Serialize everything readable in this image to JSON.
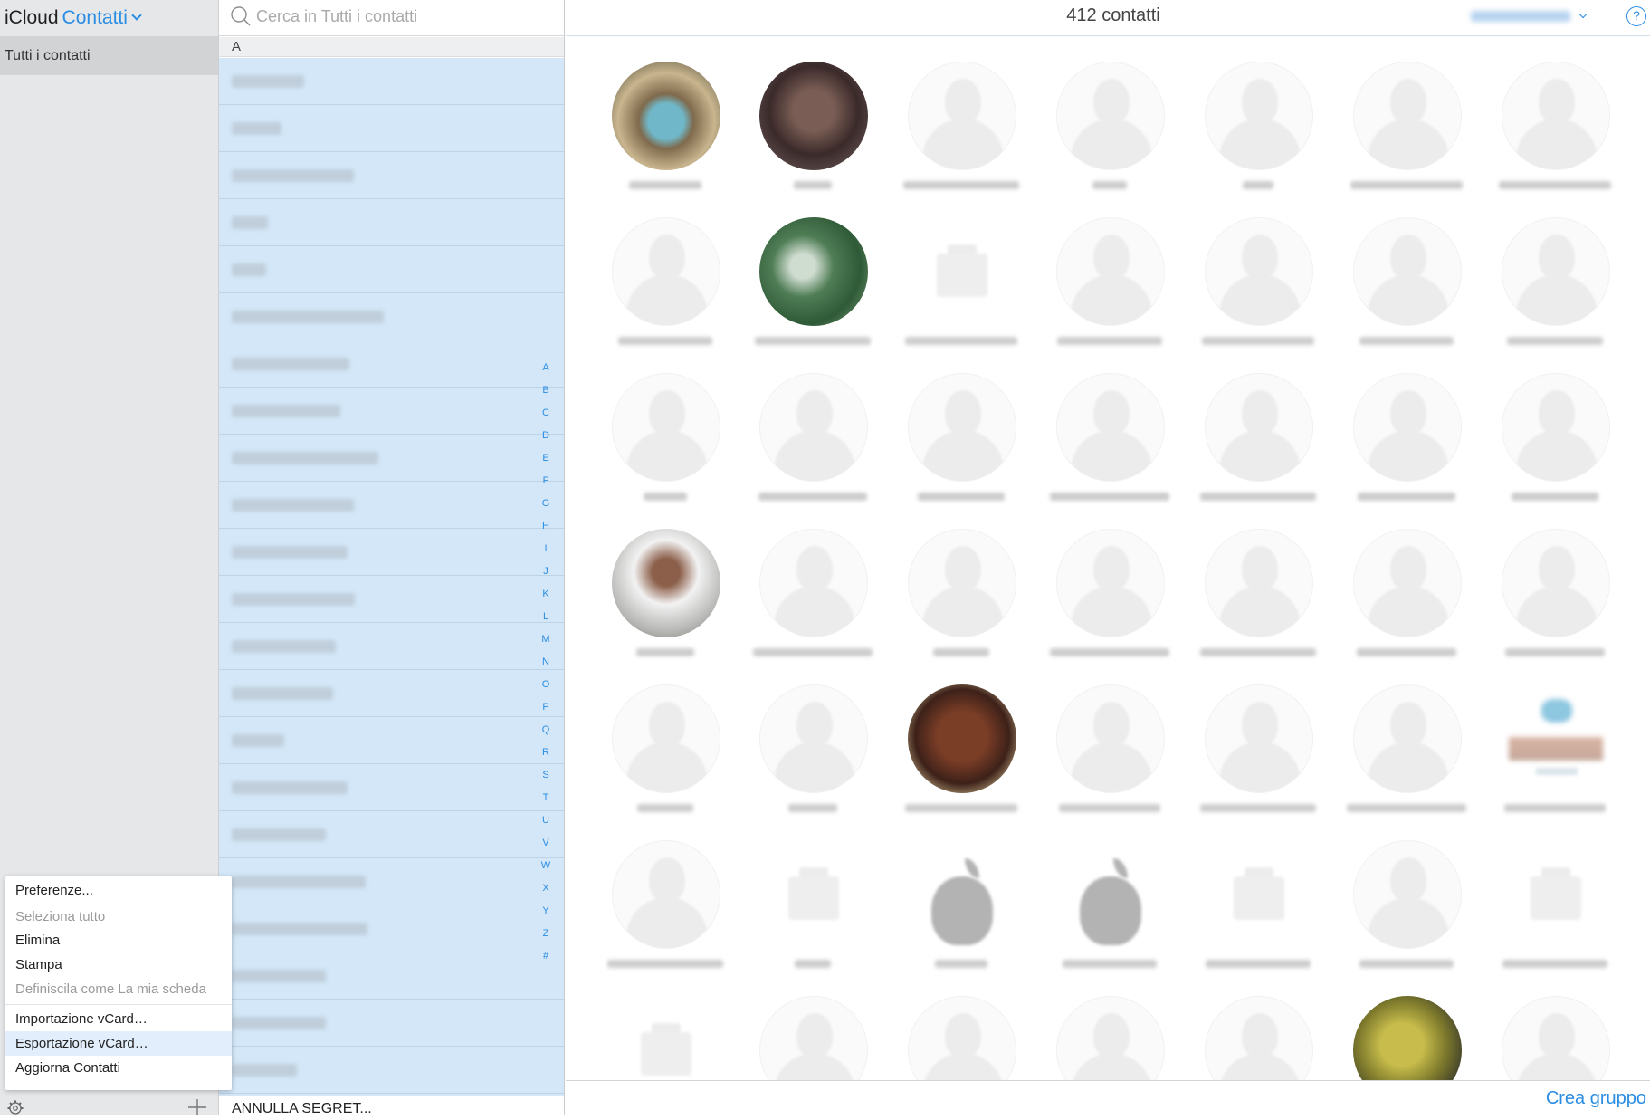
{
  "sidebar": {
    "brand": "iCloud",
    "app_name": "Contatti",
    "groups": [
      {
        "label": "Tutti i contatti"
      }
    ],
    "settings_menu": [
      {
        "label": "Preferenze...",
        "enabled": true
      },
      {
        "label": "Seleziona tutto",
        "enabled": false
      },
      {
        "label": "Elimina",
        "enabled": true
      },
      {
        "label": "Stampa",
        "enabled": true
      },
      {
        "label": "Definiscila come La mia scheda",
        "enabled": false
      },
      {
        "label": "Importazione vCard…",
        "enabled": true
      },
      {
        "label": "Esportazione vCard…",
        "enabled": true,
        "highlighted": true
      },
      {
        "label": "Aggiorna Contatti",
        "enabled": true
      }
    ]
  },
  "search": {
    "placeholder": "Cerca in Tutti i contatti"
  },
  "list": {
    "section_header": "A",
    "alphabet_index": [
      "A",
      "B",
      "C",
      "D",
      "E",
      "F",
      "G",
      "H",
      "I",
      "J",
      "K",
      "L",
      "M",
      "N",
      "O",
      "P",
      "Q",
      "R",
      "S",
      "T",
      "U",
      "V",
      "W",
      "X",
      "Y",
      "Z",
      "#"
    ],
    "last_row_label": "ANNULLA SEGRET..."
  },
  "main": {
    "count_label": "412 contatti",
    "help_label": "?",
    "create_group_label": "Crea gruppo"
  },
  "colors": {
    "accent": "#2a8de3",
    "list_selected_bg": "#d3e7f8",
    "sidebar_bg": "#e6e7e9"
  },
  "icons": {
    "search": "search-icon",
    "settings": "gear-icon",
    "add": "plus-icon",
    "help": "help-icon"
  }
}
